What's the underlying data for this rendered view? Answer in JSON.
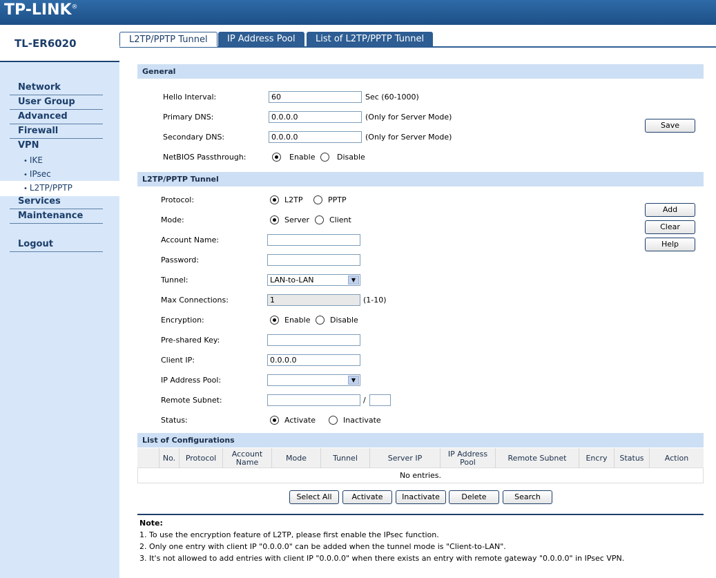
{
  "brand": {
    "logo": "TP-LINK",
    "reg": "®"
  },
  "sidebar": {
    "model": "TL-ER6020",
    "items": [
      {
        "label": "Network"
      },
      {
        "label": "User Group"
      },
      {
        "label": "Advanced"
      },
      {
        "label": "Firewall"
      },
      {
        "label": "VPN"
      },
      {
        "label": "Services"
      },
      {
        "label": "Maintenance"
      },
      {
        "label": "Logout"
      }
    ],
    "vpn_sub": [
      {
        "label": "IKE"
      },
      {
        "label": "IPsec"
      },
      {
        "label": "L2TP/PPTP"
      }
    ]
  },
  "tabs": [
    {
      "label": "L2TP/PPTP Tunnel"
    },
    {
      "label": "IP Address Pool"
    },
    {
      "label": "List of L2TP/PPTP Tunnel"
    }
  ],
  "general": {
    "title": "General",
    "hello_label": "Hello Interval:",
    "hello_value": "60",
    "hello_hint": "Sec (60-1000)",
    "pdns_label": "Primary DNS:",
    "pdns_value": "0.0.0.0",
    "pdns_hint": "(Only for Server Mode)",
    "sdns_label": "Secondary DNS:",
    "sdns_value": "0.0.0.0",
    "sdns_hint": "(Only for Server Mode)",
    "netbios_label": "NetBIOS Passthrough:",
    "netbios_enable": "Enable",
    "netbios_disable": "Disable",
    "save": "Save"
  },
  "tunnel": {
    "title": "L2TP/PPTP Tunnel",
    "protocol_label": "Protocol:",
    "protocol_l2tp": "L2TP",
    "protocol_pptp": "PPTP",
    "mode_label": "Mode:",
    "mode_server": "Server",
    "mode_client": "Client",
    "account_label": "Account Name:",
    "account_value": "",
    "password_label": "Password:",
    "password_value": "",
    "tunnel_label": "Tunnel:",
    "tunnel_value": "LAN-to-LAN",
    "maxconn_label": "Max Connections:",
    "maxconn_value": "1",
    "maxconn_hint": "(1-10)",
    "enc_label": "Encryption:",
    "enc_enable": "Enable",
    "enc_disable": "Disable",
    "psk_label": "Pre-shared Key:",
    "psk_value": "",
    "clientip_label": "Client IP:",
    "clientip_value": "0.0.0.0",
    "pool_label": "IP Address Pool:",
    "pool_value": "",
    "subnet_label": "Remote Subnet:",
    "subnet_value": "",
    "subnet_sep": "/",
    "subnet_mask": "",
    "status_label": "Status:",
    "status_activate": "Activate",
    "status_inactivate": "Inactivate",
    "add": "Add",
    "clear": "Clear",
    "help": "Help"
  },
  "list": {
    "title": "List of Configurations",
    "columns": [
      "",
      "No.",
      "Protocol",
      "Account\nName",
      "Mode",
      "Tunnel",
      "Server IP",
      "IP Address\nPool",
      "Remote Subnet",
      "Encry",
      "Status",
      "Action"
    ],
    "empty": "No entries.",
    "buttons": [
      "Select All",
      "Activate",
      "Inactivate",
      "Delete",
      "Search"
    ]
  },
  "note": {
    "title": "Note:",
    "lines": [
      "1. To use the encryption feature of L2TP, please first enable the IPsec function.",
      "2. Only one entry with client IP \"0.0.0.0\" can be added when the tunnel mode is \"Client-to-LAN\".",
      "3. It's not allowed to add entries with client IP \"0.0.0.0\" when there exists an entry with remote gateway \"0.0.0.0\" in IPsec VPN."
    ]
  },
  "colors": {
    "header": "#1d4f86",
    "sidebar": "#d7e7f9",
    "section": "#cddff4",
    "accent": "#1c3e6a"
  }
}
